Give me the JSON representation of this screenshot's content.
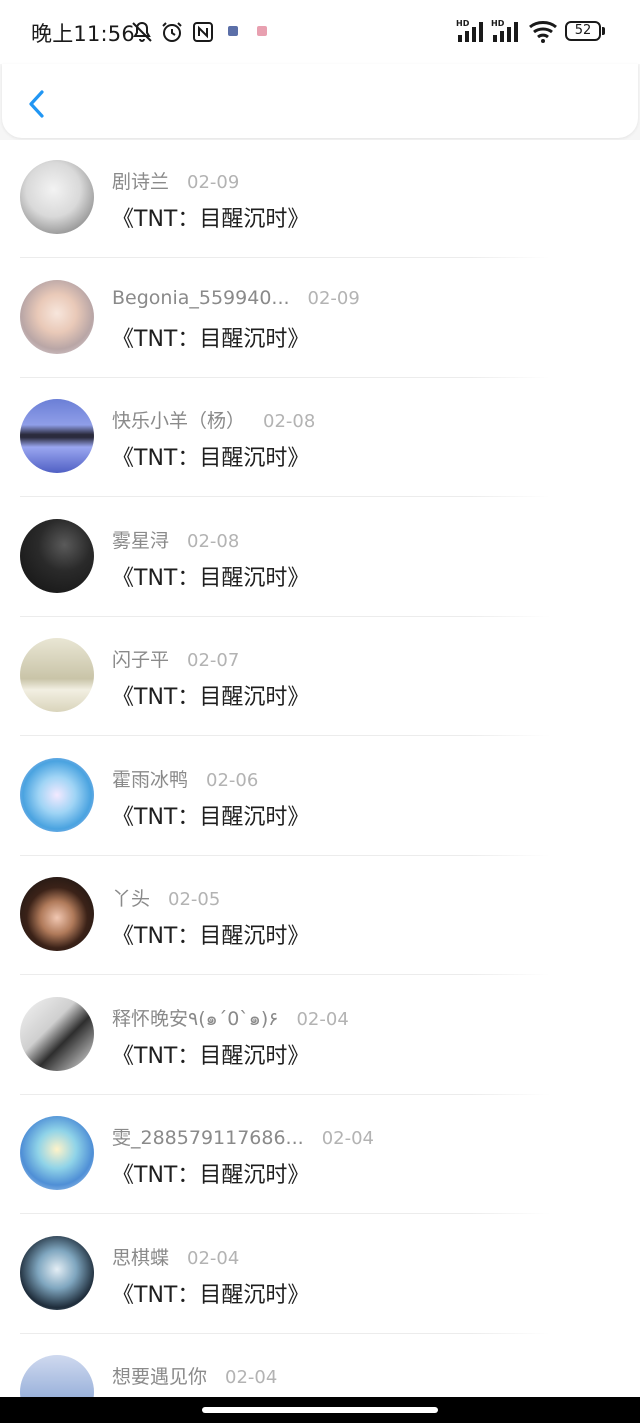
{
  "status_bar": {
    "time": "晚上11:56",
    "battery": "52",
    "hd_label": "HD"
  },
  "header": {
    "back_icon": "chevron-left-icon",
    "accent_color": "#2196f3"
  },
  "message": "《TNT：目醒沉时》",
  "items": [
    {
      "name": "剧诗兰",
      "date": "02-09",
      "avatar": "anime-sketch-avatar"
    },
    {
      "name": "Begonia_559940...",
      "date": "02-09",
      "avatar": "blonde-girl-avatar"
    },
    {
      "name": "快乐小羊（杨）",
      "date": "02-08",
      "avatar": "group-reflection-avatar"
    },
    {
      "name": "雾星浔",
      "date": "02-08",
      "avatar": "dark-silhouette-avatar"
    },
    {
      "name": "闪子平",
      "date": "02-07",
      "avatar": "girl-with-text-avatar"
    },
    {
      "name": "霍雨冰鸭",
      "date": "02-06",
      "avatar": "anime-blue-hair-avatar"
    },
    {
      "name": "   丫头",
      "date": "02-05",
      "avatar": "cartoon-girl-avatar"
    },
    {
      "name": "释怀晚安٩(๑´0`๑)۶",
      "date": "02-04",
      "avatar": "monochrome-sketch-avatar"
    },
    {
      "name": "雯_288579117686...",
      "date": "02-04",
      "avatar": "anime-teal-avatar"
    },
    {
      "name": "思棋蝶",
      "date": "02-04",
      "avatar": "anime-dark-hair-avatar"
    },
    {
      "name": "想要遇见你",
      "date": "02-04",
      "avatar": "sky-avatar"
    }
  ]
}
